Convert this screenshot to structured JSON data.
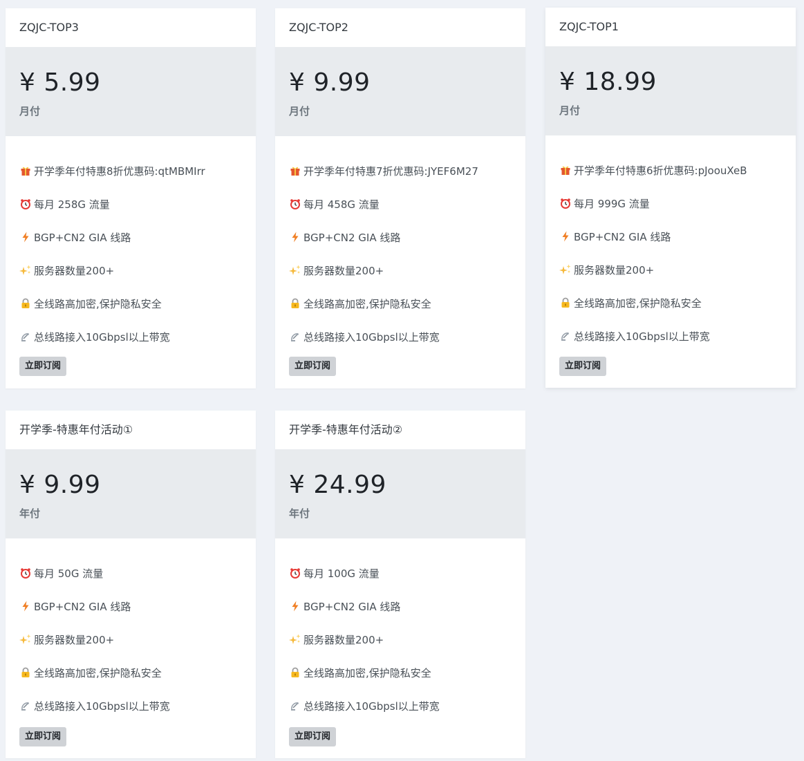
{
  "plans": [
    {
      "title": "ZQJC-TOP3",
      "price": "¥ 5.99",
      "period": "月付",
      "features": [
        {
          "icon": "gift-icon",
          "text": "开学季年付特惠8折优惠码:qtMBMIrr"
        },
        {
          "icon": "alarm-clock-icon",
          "text": "每月 258G 流量"
        },
        {
          "icon": "lightning-icon",
          "text": "BGP+CN2 GIA 线路"
        },
        {
          "icon": "sparkles-icon",
          "text": "服务器数量200+"
        },
        {
          "icon": "lock-icon",
          "text": "全线路高加密,保护隐私安全"
        },
        {
          "icon": "satellite-icon",
          "text": "总线路接入10Gbpsl以上带宽"
        }
      ],
      "button": "立即订阅"
    },
    {
      "title": "ZQJC-TOP2",
      "price": "¥ 9.99",
      "period": "月付",
      "features": [
        {
          "icon": "gift-icon",
          "text": "开学季年付特惠7折优惠码:JYEF6M27"
        },
        {
          "icon": "alarm-clock-icon",
          "text": "每月 458G 流量"
        },
        {
          "icon": "lightning-icon",
          "text": "BGP+CN2 GIA 线路"
        },
        {
          "icon": "sparkles-icon",
          "text": "服务器数量200+"
        },
        {
          "icon": "lock-icon",
          "text": "全线路高加密,保护隐私安全"
        },
        {
          "icon": "satellite-icon",
          "text": "总线路接入10Gbpsl以上带宽"
        }
      ],
      "button": "立即订阅"
    },
    {
      "title": "ZQJC-TOP1",
      "price": "¥ 18.99",
      "period": "月付",
      "features": [
        {
          "icon": "gift-icon",
          "text": "开学季年付特惠6折优惠码:pJoouXeB"
        },
        {
          "icon": "alarm-clock-icon",
          "text": "每月 999G 流量"
        },
        {
          "icon": "lightning-icon",
          "text": "BGP+CN2 GIA 线路"
        },
        {
          "icon": "sparkles-icon",
          "text": "服务器数量200+"
        },
        {
          "icon": "lock-icon",
          "text": "全线路高加密,保护隐私安全"
        },
        {
          "icon": "satellite-icon",
          "text": "总线路接入10Gbpsl以上带宽"
        }
      ],
      "button": "立即订阅"
    },
    {
      "title": "开学季-特惠年付活动①",
      "price": "¥ 9.99",
      "period": "年付",
      "features": [
        {
          "icon": "alarm-clock-icon",
          "text": "每月 50G 流量"
        },
        {
          "icon": "lightning-icon",
          "text": "BGP+CN2 GIA 线路"
        },
        {
          "icon": "sparkles-icon",
          "text": "服务器数量200+"
        },
        {
          "icon": "lock-icon",
          "text": "全线路高加密,保护隐私安全"
        },
        {
          "icon": "satellite-icon",
          "text": "总线路接入10Gbpsl以上带宽"
        }
      ],
      "button": "立即订阅"
    },
    {
      "title": "开学季-特惠年付活动②",
      "price": "¥ 24.99",
      "period": "年付",
      "features": [
        {
          "icon": "alarm-clock-icon",
          "text": "每月 100G 流量"
        },
        {
          "icon": "lightning-icon",
          "text": "BGP+CN2 GIA 线路"
        },
        {
          "icon": "sparkles-icon",
          "text": "服务器数量200+"
        },
        {
          "icon": "lock-icon",
          "text": "全线路高加密,保护隐私安全"
        },
        {
          "icon": "satellite-icon",
          "text": "总线路接入10Gbpsl以上带宽"
        }
      ],
      "button": "立即订阅"
    }
  ]
}
